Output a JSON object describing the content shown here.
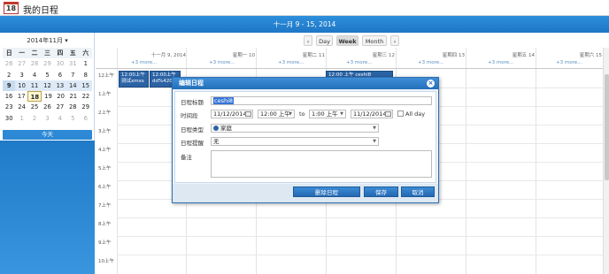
{
  "app": {
    "icon_text": "18",
    "title": "我的日程"
  },
  "header": {
    "range": "十一月 9 - 15, 2014"
  },
  "toolbar": {
    "prev": "‹",
    "day": "Day",
    "week": "Week",
    "month": "Month",
    "next": "›"
  },
  "mini_calendar": {
    "month_label": "2014年11月 ▾",
    "dow": [
      "日",
      "一",
      "二",
      "三",
      "四",
      "五",
      "六"
    ],
    "weeks": [
      [
        "26",
        "27",
        "28",
        "29",
        "30",
        "31",
        "1"
      ],
      [
        "2",
        "3",
        "4",
        "5",
        "6",
        "7",
        "8"
      ],
      [
        "9",
        "10",
        "11",
        "12",
        "13",
        "14",
        "15"
      ],
      [
        "16",
        "17",
        "18",
        "19",
        "20",
        "21",
        "22"
      ],
      [
        "23",
        "24",
        "25",
        "26",
        "27",
        "28",
        "29"
      ],
      [
        "30",
        "1",
        "2",
        "3",
        "4",
        "5",
        "6"
      ]
    ],
    "today_button": "今天"
  },
  "week_columns": [
    {
      "head": "十一月 9, 2014",
      "more": "+3 more..."
    },
    {
      "head": "星期一 10",
      "more": "+3 more..."
    },
    {
      "head": "星期二 11",
      "more": "+3 more..."
    },
    {
      "head": "星期三 12",
      "more": "+3 more..."
    },
    {
      "head": "星期四 13",
      "more": "+3 more..."
    },
    {
      "head": "星期五 14",
      "more": "+3 more..."
    },
    {
      "head": "星期六 15",
      "more": "+3 more..."
    }
  ],
  "time_labels": [
    "12上午",
    "1上午",
    "2上午",
    "3上午",
    "4上午",
    "5上午",
    "6上午",
    "7上午",
    "8上午",
    "9上午",
    "10上午"
  ],
  "events": [
    {
      "time": "12:00上午",
      "title": "测试xmxs"
    },
    {
      "time": "12:00上午",
      "title": "dd%4204"
    },
    {
      "time": "12:00 上午",
      "title": "ceshi8"
    }
  ],
  "dialog": {
    "title": "编辑日程",
    "close": "×",
    "labels": {
      "subject": "日程标题",
      "period": "时间段",
      "type": "日程类型",
      "reminder": "日程提醒",
      "note": "备注"
    },
    "subject_value": "ceshi8",
    "start_date": "11/12/2014",
    "start_time": "12:00 上午",
    "to": "to",
    "end_time": "1:00 上午",
    "end_date": "11/12/2014",
    "all_day": "All day",
    "type_value": "家庭",
    "type_color": "#2b63a5",
    "reminder_value": "无",
    "note_value": "",
    "buttons": {
      "delete": "删除日程",
      "save": "保存",
      "cancel": "取消"
    }
  }
}
